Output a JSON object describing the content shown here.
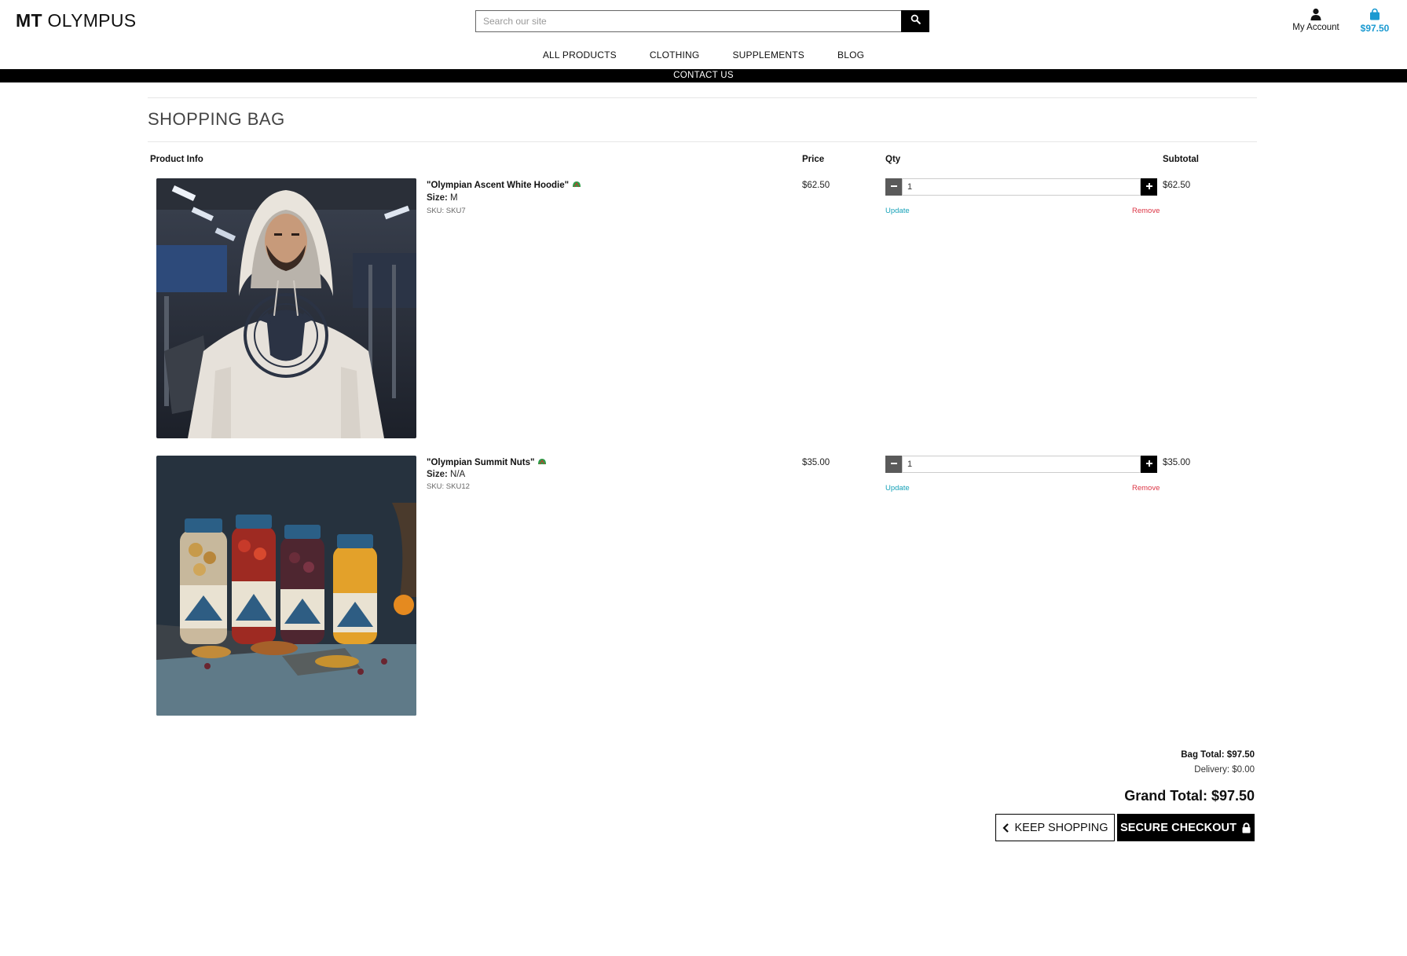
{
  "header": {
    "logo_bold": "MT",
    "logo_rest": " OLYMPUS",
    "search": {
      "placeholder": "Search our site",
      "value": ""
    },
    "account_label": "My Account",
    "bag_total": "$97.50"
  },
  "nav": {
    "items": [
      {
        "label": "ALL PRODUCTS"
      },
      {
        "label": "CLOTHING"
      },
      {
        "label": "SUPPLEMENTS"
      },
      {
        "label": "BLOG"
      }
    ],
    "contact_label": "CONTACT US"
  },
  "page": {
    "title": "SHOPPING BAG"
  },
  "table": {
    "headers": {
      "product": "Product Info",
      "price": "Price",
      "qty": "Qty",
      "subtotal": "Subtotal"
    },
    "items": [
      {
        "name": "\"Olympian Ascent White Hoodie\"",
        "size_label": "Size:",
        "size": "M",
        "sku": "SKU: SKU7",
        "price": "$62.50",
        "qty": "1",
        "subtotal": "$62.50",
        "update_label": "Update",
        "remove_label": "Remove",
        "image_icon": "hoodie-product-photo"
      },
      {
        "name": "\"Olympian Summit Nuts\"",
        "size_label": "Size:",
        "size": "N/A",
        "sku": "SKU: SKU12",
        "price": "$35.00",
        "qty": "1",
        "subtotal": "$35.00",
        "update_label": "Update",
        "remove_label": "Remove",
        "image_icon": "nuts-jars-product-photo"
      }
    ]
  },
  "summary": {
    "bag_total": "Bag Total: $97.50",
    "delivery": "Delivery: $0.00",
    "grand_total": "Grand Total: $97.50"
  },
  "buttons": {
    "keep_shopping": "KEEP SHOPPING",
    "secure_checkout": "SECURE CHECKOUT"
  },
  "colors": {
    "accent": "#1b9ad1",
    "update_link": "#17a2b8",
    "remove_link": "#dc3545",
    "dark": "#000000"
  }
}
